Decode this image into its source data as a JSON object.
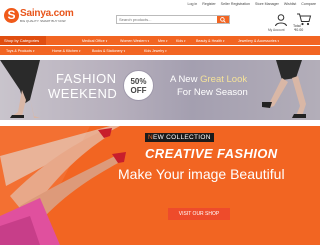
{
  "top_links": [
    "Log in",
    "Register",
    "Seller Registration",
    "Store Manager",
    "Wishlist",
    "Compare"
  ],
  "logo": {
    "mark": "S",
    "name": "Sainya.com",
    "tagline": "BIG QUALITY. SMART BUY NOW"
  },
  "search": {
    "placeholder": "Search products..."
  },
  "account": {
    "label": "My Account"
  },
  "cart": {
    "label": "Total",
    "amount": "₹0.00"
  },
  "nav": {
    "categories_label": "Shop by Categories",
    "items": [
      "Medical Office",
      "Women Western",
      "Men",
      "Kids",
      "Beauty & Health",
      "Jewellery & Accessories"
    ]
  },
  "subnav": {
    "items": [
      "Toys & Products",
      "Home & Kitchen",
      "Books & Stationery",
      "Kids Jewelry"
    ]
  },
  "banner1": {
    "title_line1": "FASHION",
    "title_line2": "WEEKEND",
    "badge_percent": "50%",
    "badge_off": "OFF",
    "line1_pre": "A New ",
    "line1_highlight": "Great Look",
    "line2": "For New Season"
  },
  "hero": {
    "tag_first": "N",
    "tag_rest": "EW COLLECTION",
    "title": "CREATIVE FASHION",
    "subtitle": "Make Your image Beautiful",
    "button_label": "VISIT OUR SHOP"
  },
  "colors": {
    "brand": "#f26522",
    "nav_dark": "#e04e10"
  }
}
